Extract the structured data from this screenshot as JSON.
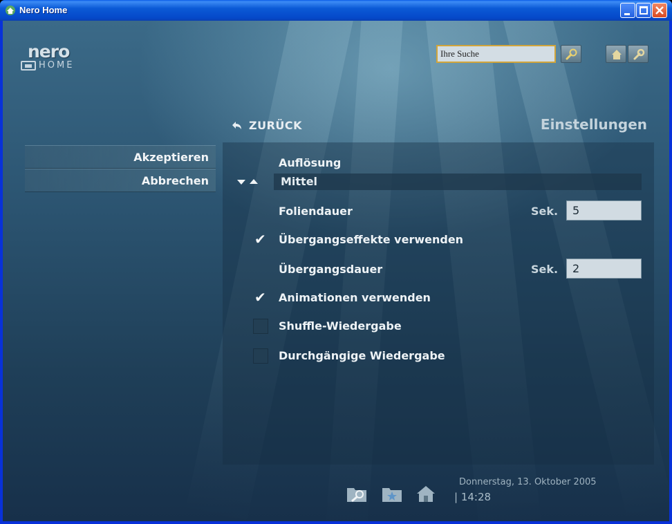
{
  "window": {
    "title": "Nero Home"
  },
  "logo": {
    "brand": "nero",
    "product": "HOME"
  },
  "search": {
    "value": "Ihre Suche"
  },
  "nav": {
    "back_label": "ZURÜCK",
    "page_title": "Einstellungen"
  },
  "sidebar": {
    "items": [
      {
        "label": "Akzeptieren"
      },
      {
        "label": "Abbrechen"
      }
    ]
  },
  "settings": {
    "resolution": {
      "label": "Auflösung",
      "value": "Mittel"
    },
    "slide_duration": {
      "label": "Foliendauer",
      "unit": "Sek.",
      "value": "5"
    },
    "use_transitions": {
      "label": "Übergangseffekte verwenden",
      "checked": true
    },
    "transition_duration": {
      "label": "Übergangsdauer",
      "unit": "Sek.",
      "value": "2"
    },
    "use_animations": {
      "label": "Animationen verwenden",
      "checked": true
    },
    "shuffle": {
      "label": "Shuffle-Wiedergabe",
      "checked": false
    },
    "continuous": {
      "label": "Durchgängige Wiedergabe",
      "checked": false
    }
  },
  "footer": {
    "date": "Donnerstag, 13. Oktober 2005",
    "time": "| 14:28"
  },
  "icons": {
    "app": "nero-home-icon",
    "search": "magnifier-icon",
    "home": "home-icon",
    "tools": "wrench-icon",
    "back": "back-arrow-icon",
    "dock": [
      "search-folder-icon",
      "favorites-folder-icon",
      "home-icon"
    ]
  },
  "colors": {
    "titlebar": "#0548c8",
    "search_border": "#d2a53a",
    "panel_text": "#eef3f6",
    "close_button": "#d94a22"
  }
}
